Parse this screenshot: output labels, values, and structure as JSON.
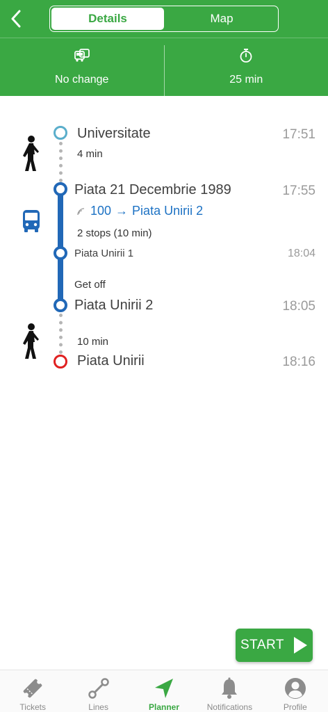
{
  "header": {
    "tabs": [
      {
        "label": "Details",
        "active": true
      },
      {
        "label": "Map",
        "active": false
      }
    ],
    "summary": {
      "transfer_label": "No change",
      "duration_label": "25 min"
    }
  },
  "itinerary": {
    "walk1": {
      "from": "Universitate",
      "from_time": "17:51",
      "duration": "4 min"
    },
    "bus": {
      "board_stop": "Piata 21 Decembrie 1989",
      "board_time": "17:55",
      "line": "100",
      "arrow": "→",
      "direction": "Piata Unirii 2",
      "stops_info": "2 stops (10 min)",
      "intermediate_stop": "Piata Unirii 1",
      "intermediate_time": "18:04",
      "get_off_label": "Get off",
      "alight_stop": "Piata Unirii 2",
      "alight_time": "18:05"
    },
    "walk2": {
      "duration": "10 min",
      "destination": "Piata Unirii",
      "destination_time": "18:16"
    }
  },
  "start_button": {
    "label": "START"
  },
  "bottom_nav": [
    {
      "label": "Tickets",
      "icon": "ticket-icon",
      "active": false
    },
    {
      "label": "Lines",
      "icon": "route-icon",
      "active": false
    },
    {
      "label": "Planner",
      "icon": "navigation-arrow-icon",
      "active": true
    },
    {
      "label": "Notifications",
      "icon": "bell-icon",
      "active": false
    },
    {
      "label": "Profile",
      "icon": "profile-icon",
      "active": false
    }
  ],
  "colors": {
    "brand_green": "#3aa843",
    "bus_blue": "#2168b7",
    "origin_teal": "#5aaecb",
    "destination_red": "#e02020"
  }
}
